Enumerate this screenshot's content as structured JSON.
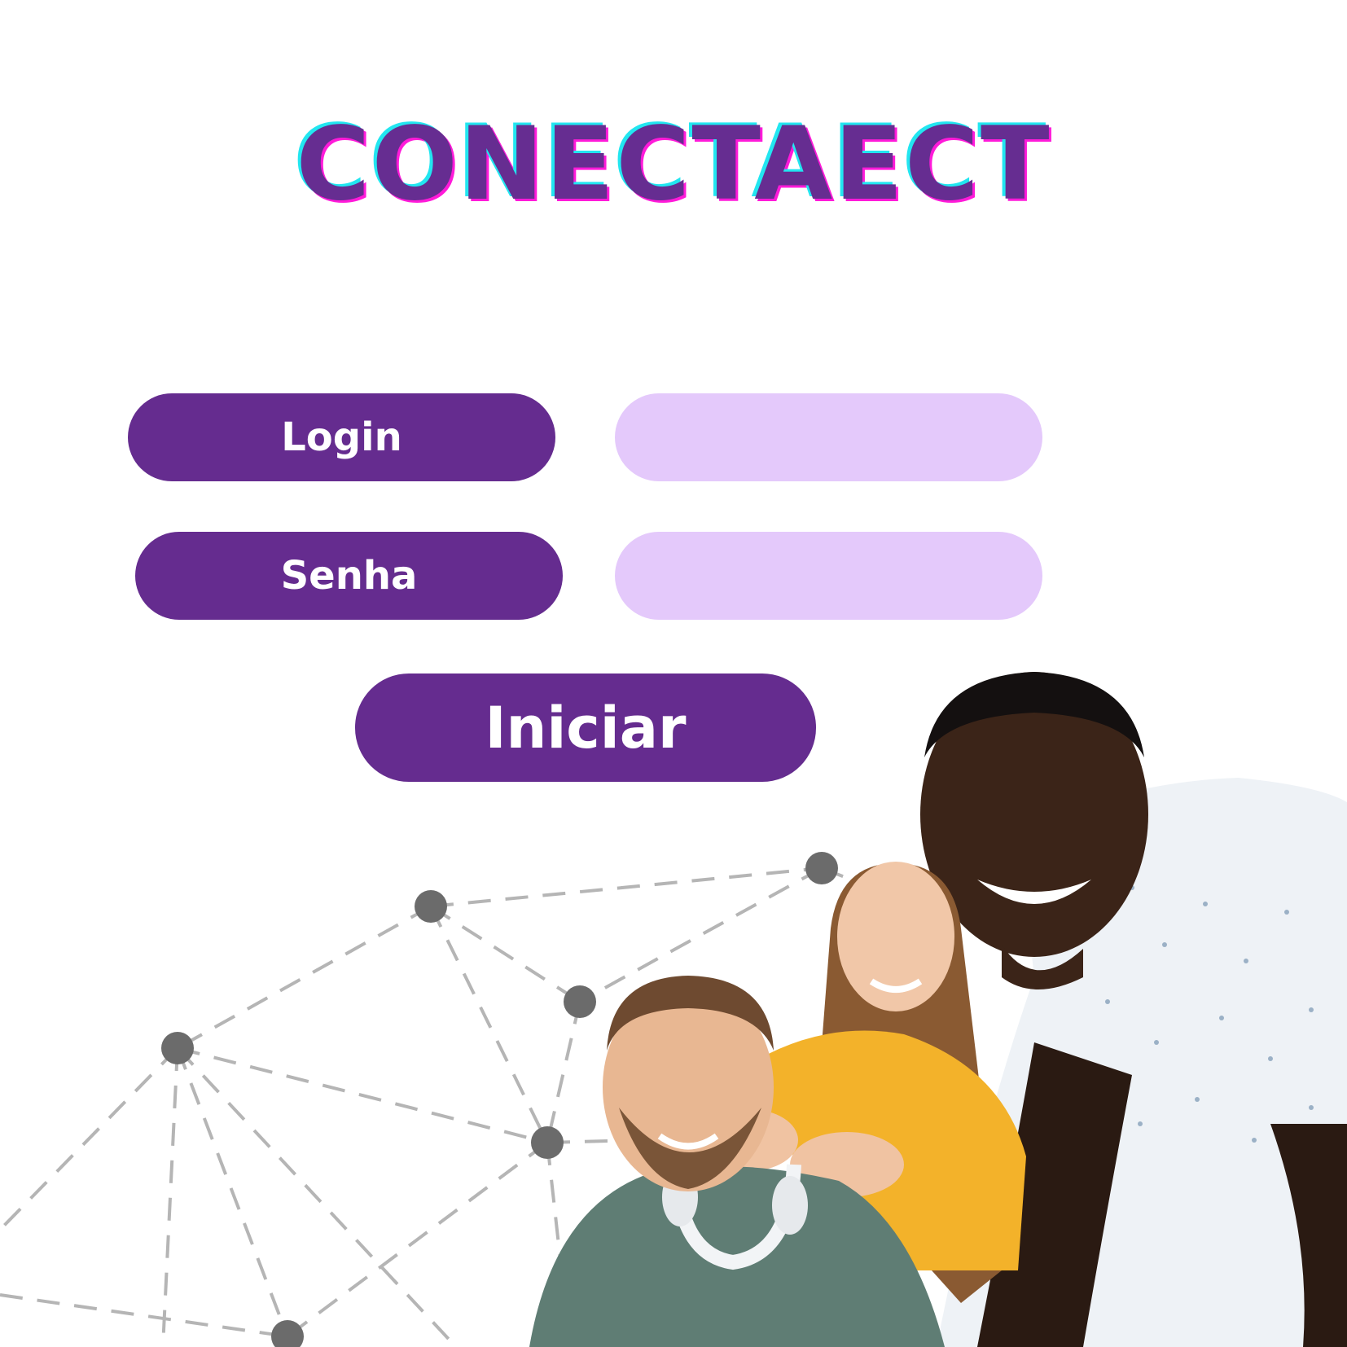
{
  "brand": {
    "title": "CONECTAECT"
  },
  "form": {
    "login_label": "Login",
    "login_value": "",
    "senha_label": "Senha",
    "senha_value": "",
    "submit_label": "Iniciar"
  },
  "colors": {
    "primary": "#652c8f",
    "input_fill": "#e4c9fb",
    "logo_shadow_cyan": "#22e6f0",
    "logo_shadow_magenta": "#ff1ad9",
    "network_lines": "#b5b5b5",
    "network_nodes": "#6b6b6b"
  }
}
